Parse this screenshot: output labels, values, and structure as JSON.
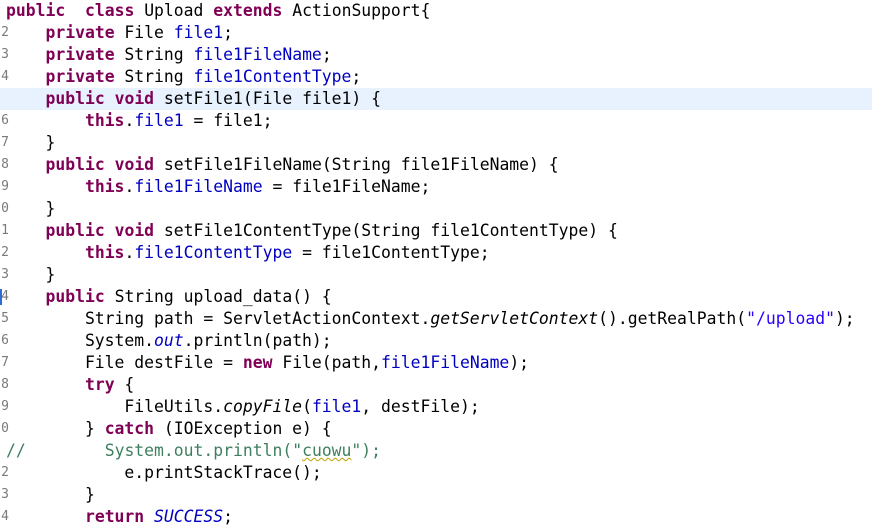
{
  "editor": {
    "title": "",
    "lines": [
      {
        "gutter": "",
        "tokens": [
          [
            "kw",
            "public"
          ],
          [
            "",
            "  "
          ],
          [
            "kw",
            "class"
          ],
          [
            "",
            " "
          ],
          [
            "",
            "Upload"
          ],
          [
            "",
            " "
          ],
          [
            "kw",
            "extends"
          ],
          [
            "",
            " "
          ],
          [
            "",
            "ActionSupport{"
          ]
        ]
      },
      {
        "gutter": "2",
        "tokens": [
          [
            "",
            "    "
          ],
          [
            "kw",
            "private"
          ],
          [
            "",
            " File "
          ],
          [
            "fld",
            "file1"
          ],
          [
            "",
            ";"
          ]
        ]
      },
      {
        "gutter": "3",
        "tokens": [
          [
            "",
            "    "
          ],
          [
            "kw",
            "private"
          ],
          [
            "",
            " String "
          ],
          [
            "fld",
            "file1FileName"
          ],
          [
            "",
            ";"
          ]
        ]
      },
      {
        "gutter": "4",
        "tokens": [
          [
            "",
            "    "
          ],
          [
            "kw",
            "private"
          ],
          [
            "",
            " String "
          ],
          [
            "fld",
            "file1ContentType"
          ],
          [
            "",
            ";"
          ]
        ]
      },
      {
        "gutter": "",
        "current": true,
        "tokens": [
          [
            "",
            "    "
          ],
          [
            "kw",
            "public"
          ],
          [
            "",
            " "
          ],
          [
            "kw",
            "void"
          ],
          [
            "",
            " setFile1(File file1) {"
          ]
        ]
      },
      {
        "gutter": "6",
        "tokens": [
          [
            "",
            "        "
          ],
          [
            "kw",
            "this"
          ],
          [
            "",
            "."
          ],
          [
            "fld",
            "file1"
          ],
          [
            "",
            " = file1;"
          ]
        ]
      },
      {
        "gutter": "7",
        "tokens": [
          [
            "",
            "    }"
          ]
        ]
      },
      {
        "gutter": "8",
        "tokens": [
          [
            "",
            "    "
          ],
          [
            "kw",
            "public"
          ],
          [
            "",
            " "
          ],
          [
            "kw",
            "void"
          ],
          [
            "",
            " setFile1FileName(String file1FileName) {"
          ]
        ]
      },
      {
        "gutter": "9",
        "tokens": [
          [
            "",
            "        "
          ],
          [
            "kw",
            "this"
          ],
          [
            "",
            "."
          ],
          [
            "fld",
            "file1FileName"
          ],
          [
            "",
            " = file1FileName;"
          ]
        ]
      },
      {
        "gutter": "0",
        "tokens": [
          [
            "",
            "    }"
          ]
        ]
      },
      {
        "gutter": "1",
        "tokens": [
          [
            "",
            "    "
          ],
          [
            "kw",
            "public"
          ],
          [
            "",
            " "
          ],
          [
            "kw",
            "void"
          ],
          [
            "",
            " setFile1ContentType(String file1ContentType) {"
          ]
        ]
      },
      {
        "gutter": "2",
        "tokens": [
          [
            "",
            "        "
          ],
          [
            "kw",
            "this"
          ],
          [
            "",
            "."
          ],
          [
            "fld",
            "file1ContentType"
          ],
          [
            "",
            " = file1ContentType;"
          ]
        ]
      },
      {
        "gutter": "3",
        "tokens": [
          [
            "",
            "    }"
          ]
        ]
      },
      {
        "gutter": "4",
        "marker": true,
        "tokens": [
          [
            "",
            "    "
          ],
          [
            "kw",
            "public"
          ],
          [
            "",
            " String upload_data() {"
          ]
        ]
      },
      {
        "gutter": "5",
        "tokens": [
          [
            "",
            "        String path = ServletActionContext."
          ],
          [
            "it",
            "getServletContext"
          ],
          [
            "",
            "().getRealPath("
          ],
          [
            "str",
            "\"/upload\""
          ],
          [
            "",
            ");"
          ]
        ]
      },
      {
        "gutter": "6",
        "tokens": [
          [
            "",
            "        System."
          ],
          [
            "fld it",
            "out"
          ],
          [
            "",
            ".println(path);"
          ]
        ]
      },
      {
        "gutter": "7",
        "tokens": [
          [
            "",
            "        File destFile = "
          ],
          [
            "kw",
            "new"
          ],
          [
            "",
            " File(path,"
          ],
          [
            "fld",
            "file1FileName"
          ],
          [
            "",
            ");"
          ]
        ]
      },
      {
        "gutter": "8",
        "tokens": [
          [
            "",
            "        "
          ],
          [
            "kw",
            "try"
          ],
          [
            "",
            " {"
          ]
        ]
      },
      {
        "gutter": "9",
        "tokens": [
          [
            "",
            "            FileUtils."
          ],
          [
            "it",
            "copyFile"
          ],
          [
            "",
            "("
          ],
          [
            "fld",
            "file1"
          ],
          [
            "",
            ", destFile);"
          ]
        ]
      },
      {
        "gutter": "0",
        "tokens": [
          [
            "",
            "        } "
          ],
          [
            "kw",
            "catch"
          ],
          [
            "",
            " (IOException e) {"
          ]
        ]
      },
      {
        "gutter": "",
        "tokens": [
          [
            "cmt",
            "//"
          ],
          [
            "",
            "        "
          ],
          [
            "cmt",
            "System.out.println(\""
          ],
          [
            "cmt sq",
            "cuowu"
          ],
          [
            "cmt",
            "\");"
          ]
        ]
      },
      {
        "gutter": "2",
        "tokens": [
          [
            "",
            "            e.printStackTrace();"
          ]
        ]
      },
      {
        "gutter": "3",
        "tokens": [
          [
            "",
            "        }"
          ]
        ]
      },
      {
        "gutter": "4",
        "tokens": [
          [
            "",
            "        "
          ],
          [
            "kw",
            "return"
          ],
          [
            "",
            " "
          ],
          [
            "fld it",
            "SUCCESS"
          ],
          [
            "",
            ";"
          ]
        ]
      }
    ]
  }
}
